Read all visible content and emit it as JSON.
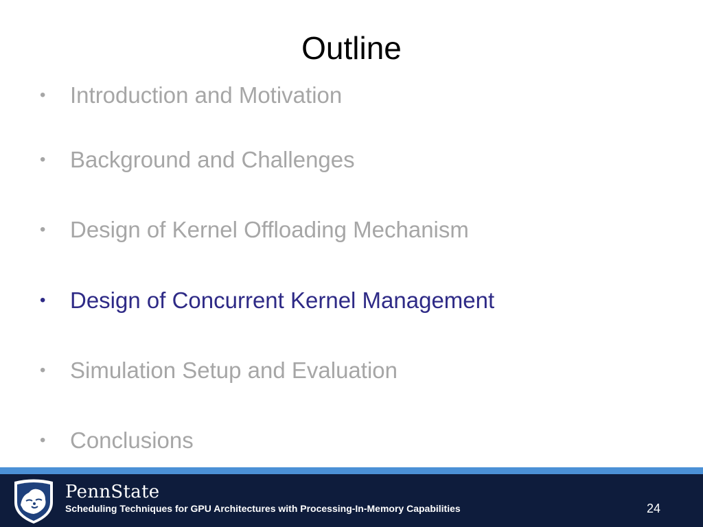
{
  "slide": {
    "title": "Outline",
    "items": [
      {
        "bullet": "•",
        "text": "Introduction and Motivation",
        "state": "muted"
      },
      {
        "bullet": "•",
        "text": "Background and Challenges",
        "state": "muted"
      },
      {
        "bullet": "•",
        "text": "Design of Kernel Offloading Mechanism",
        "state": "muted"
      },
      {
        "bullet": "•",
        "text": "Design of Concurrent Kernel Management",
        "state": "active"
      },
      {
        "bullet": "•",
        "text": "Simulation Setup and Evaluation",
        "state": "muted"
      },
      {
        "bullet": "•",
        "text": "Conclusions",
        "state": "muted"
      }
    ]
  },
  "footer": {
    "brand": "PennState",
    "subtitle": "Scheduling Techniques for GPU Architectures with Processing-In-Memory Capabilities",
    "page_number": "24",
    "logo_icon": "nittany-lion-shield-icon"
  },
  "colors": {
    "muted_text": "#a6a6a6",
    "active_text": "#2e2a86",
    "footer_bg": "#0e1c3c",
    "footer_stripe": "#4b90d6"
  }
}
